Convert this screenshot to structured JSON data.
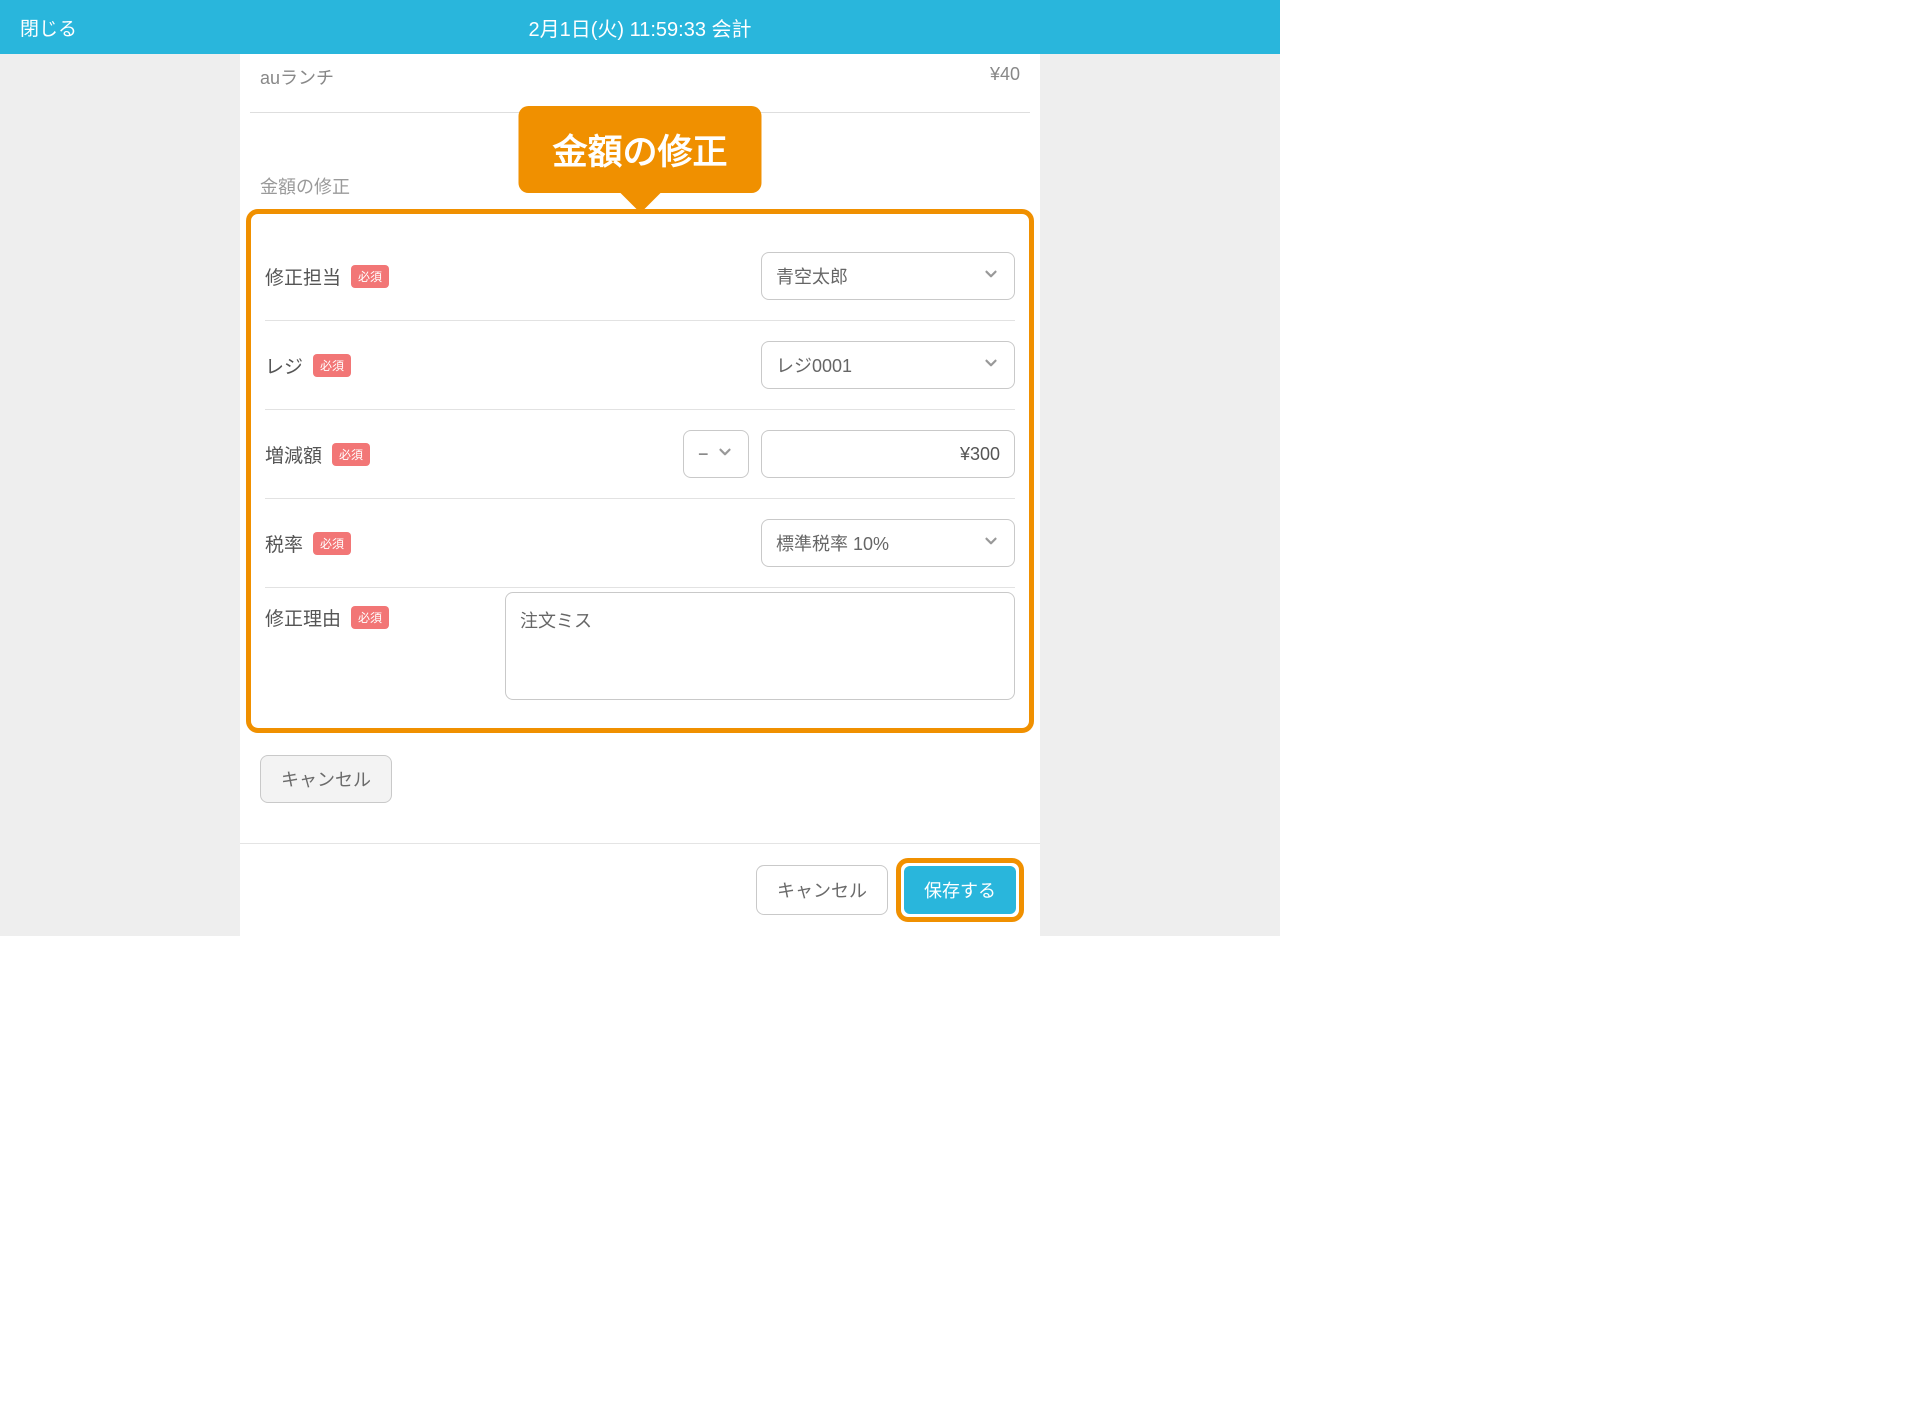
{
  "header": {
    "close_label": "閉じる",
    "title": "2月1日(火) 11:59:33 会計"
  },
  "partial_item": {
    "name": "auランチ",
    "price": "¥40"
  },
  "callout_label": "金額の修正",
  "section_label": "金額の修正",
  "form": {
    "assignee": {
      "label": "修正担当",
      "required": "必須",
      "value": "青空太郎"
    },
    "register": {
      "label": "レジ",
      "required": "必須",
      "value": "レジ0001"
    },
    "amount": {
      "label": "増減額",
      "required": "必須",
      "sign": "−",
      "value": "¥300"
    },
    "tax": {
      "label": "税率",
      "required": "必須",
      "value": "標準税率 10%"
    },
    "reason": {
      "label": "修正理由",
      "required": "必須",
      "value": "注文ミス"
    }
  },
  "buttons": {
    "cancel_inline": "キャンセル",
    "cancel_bottom": "キャンセル",
    "save": "保存する"
  }
}
